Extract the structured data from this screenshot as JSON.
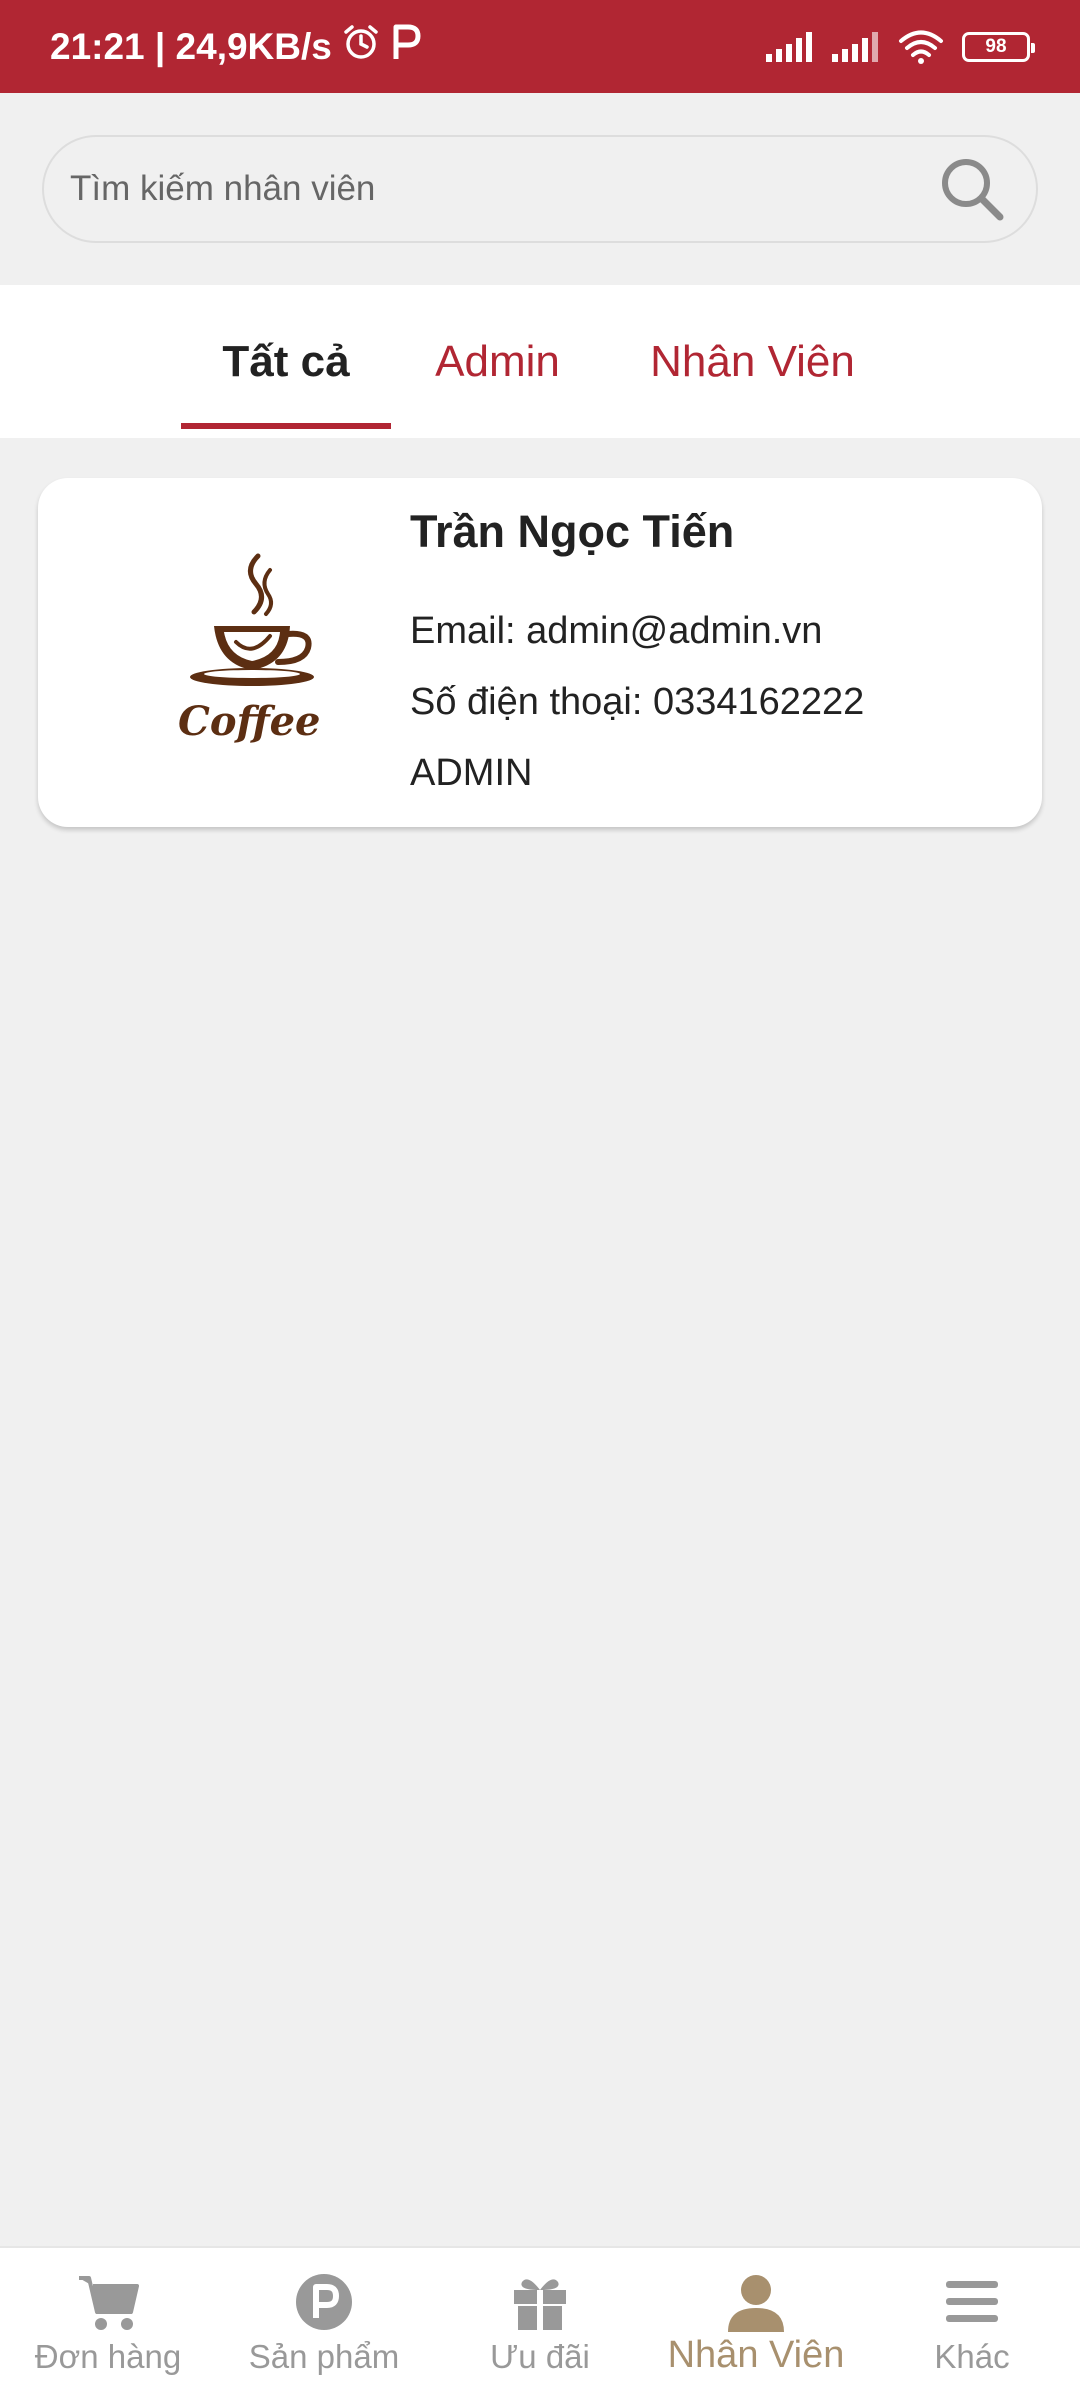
{
  "status_bar": {
    "time_speed": "21:21 | 24,9KB/s",
    "alarm_icon": "alarm-clock-icon",
    "app_icon": "p-letter-icon",
    "battery": "98"
  },
  "search": {
    "placeholder": "Tìm kiếm nhân viên",
    "icon": "search-icon"
  },
  "tabs": [
    {
      "label": "Tất cả",
      "active": true
    },
    {
      "label": "Admin",
      "active": false
    },
    {
      "label": "Nhân Viên",
      "active": false
    }
  ],
  "employees": [
    {
      "logo_text": "Coffee",
      "name": "Trần Ngọc Tiến",
      "email": "Email: admin@admin.vn",
      "phone": "Số điện thoại: 0334162222",
      "role": "ADMIN"
    }
  ],
  "bottom_nav": [
    {
      "label": "Đơn hàng",
      "icon": "cart-icon",
      "active": false
    },
    {
      "label": "Sản phẩm",
      "icon": "product-p-icon",
      "active": false
    },
    {
      "label": "Ưu đãi",
      "icon": "gift-icon",
      "active": false
    },
    {
      "label": "Nhân Viên",
      "icon": "person-icon",
      "active": true
    },
    {
      "label": "Khác",
      "icon": "menu-icon",
      "active": false
    }
  ],
  "colors": {
    "brand_red": "#b12633",
    "nav_active": "#a8906e",
    "nav_inactive": "#999999",
    "coffee_brown": "#5c2e12"
  }
}
